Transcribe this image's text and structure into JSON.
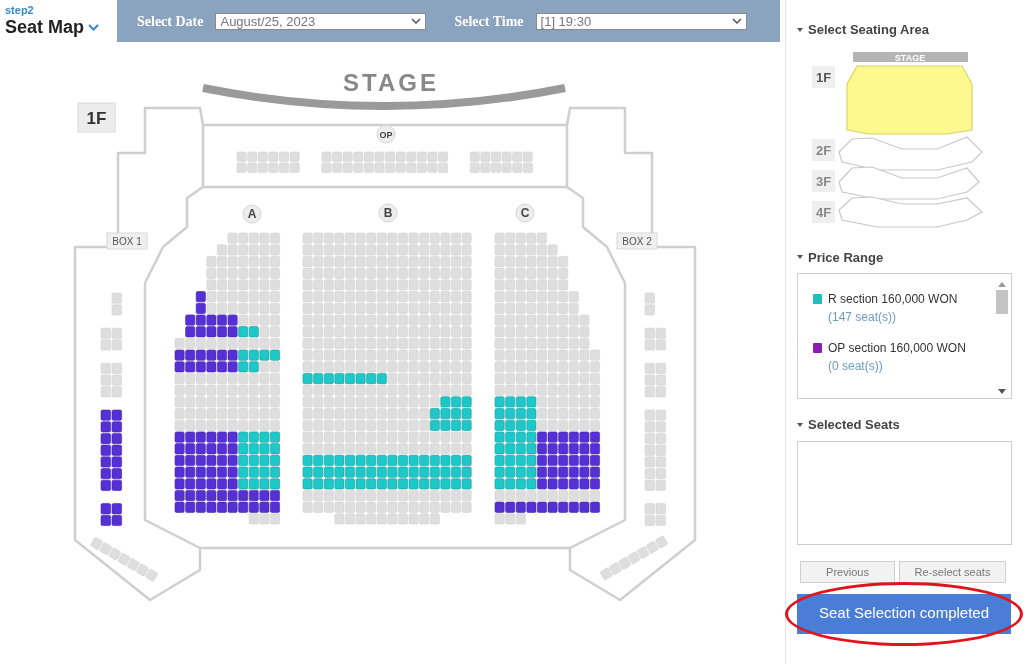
{
  "header": {
    "step": "step2",
    "title": "Seat Map",
    "date_label": "Select Date",
    "date_value": "August/25, 2023",
    "time_label": "Select Time",
    "time_value": "[1] 19:30"
  },
  "seat_map": {
    "stage": "STAGE",
    "floor": "1F",
    "sections": [
      {
        "label": "OP"
      },
      {
        "label": "A"
      },
      {
        "label": "B"
      },
      {
        "label": "C"
      },
      {
        "label": "BOX 1"
      },
      {
        "label": "BOX 2"
      }
    ]
  },
  "sidebar": {
    "area_heading": "Select Seating Area",
    "mini_stage": "STAGE",
    "floors": [
      {
        "label": "1F",
        "selected": true
      },
      {
        "label": "2F",
        "selected": false
      },
      {
        "label": "3F",
        "selected": false
      },
      {
        "label": "4F",
        "selected": false
      }
    ],
    "price_heading": "Price Range",
    "prices": [
      {
        "label": "R section 160,000 WON",
        "count": "(147 seat(s))",
        "color": "#1fbfbf"
      },
      {
        "label": "OP section 160,000 WON",
        "count": "(0 seat(s))",
        "color": "#8a1fb8"
      }
    ],
    "selected_heading": "Selected Seats",
    "buttons": [
      "Previous",
      "Re-select seats"
    ],
    "complete_button": "Seat Selection completed"
  }
}
